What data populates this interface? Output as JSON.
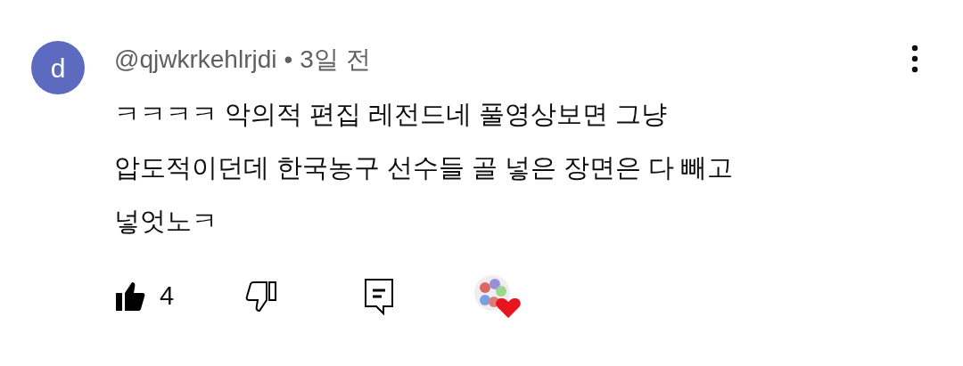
{
  "comment": {
    "avatar_letter": "d",
    "author": "@qjwkrkehlrjdi",
    "separator": "•",
    "time": "3일 전",
    "lines": [
      "ㅋㅋㅋㅋ 악의적 편집 레전드네 풀영상보면 그냥",
      "압도적이던데 한국농구 선수들 골 넣은 장면은 다 빼고",
      "넣엇노ㅋ"
    ],
    "liked": true,
    "like_count": "4",
    "disliked": false,
    "hearted": true
  }
}
